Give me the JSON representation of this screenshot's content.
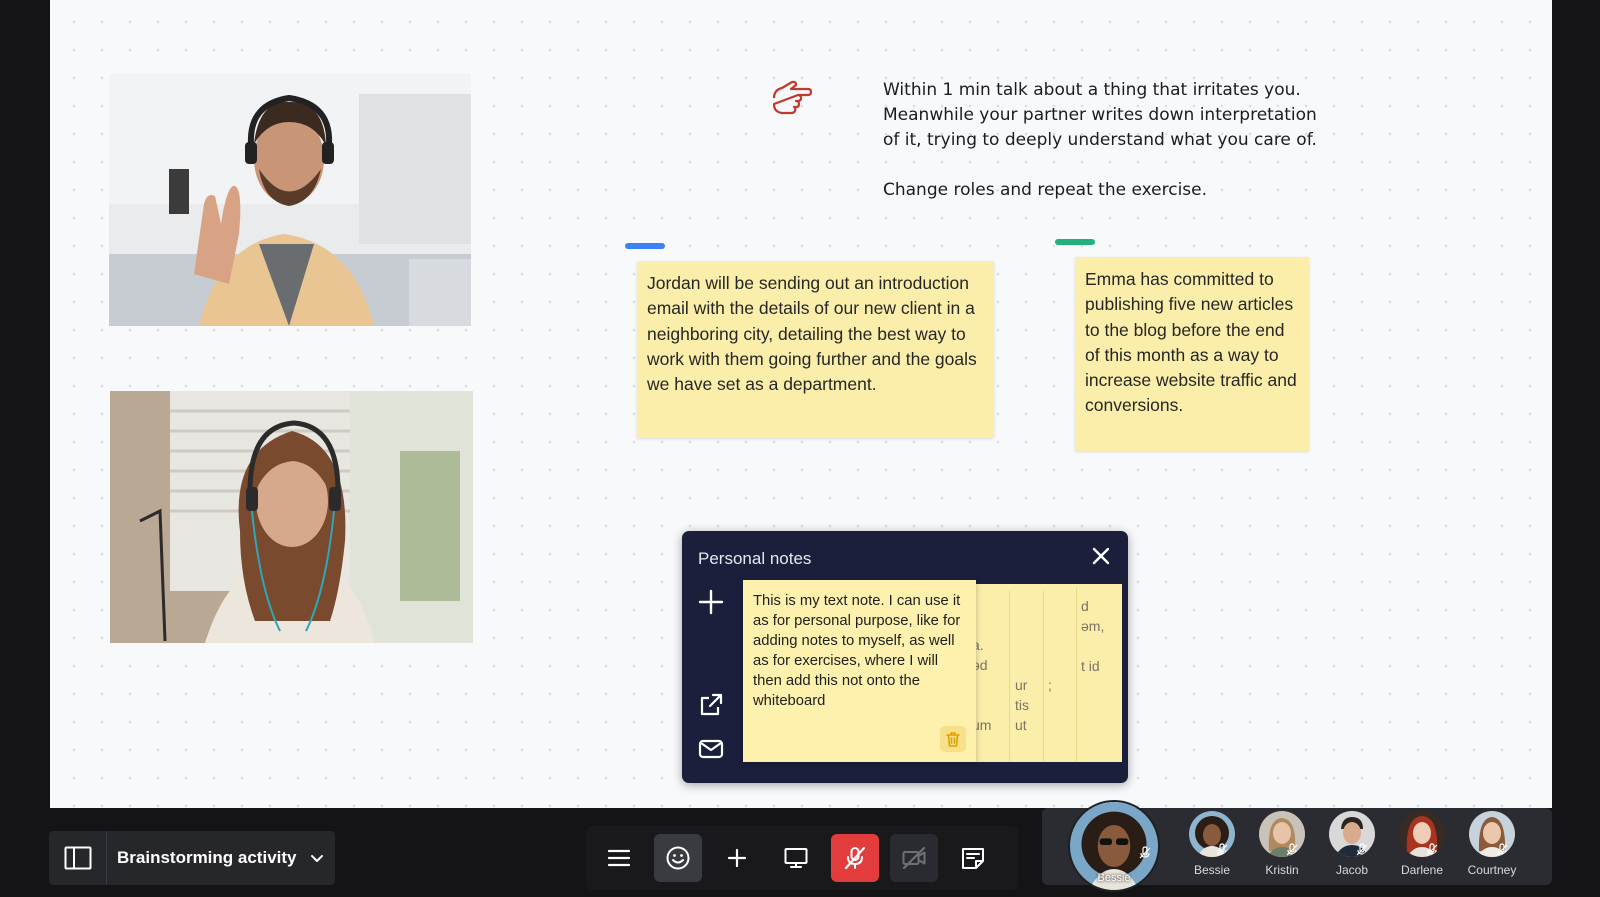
{
  "canvas": {
    "instruction": {
      "line1": "Within 1 min talk about a thing that irritates you.\nMeanwhile your partner writes down interpretation\nof it, trying to deeply understand what you care of.",
      "line2": "Change roles and repeat the exercise."
    },
    "stickies": [
      {
        "text": "Jordan will be sending out an introduction email with the details of our new client in a neighboring city, detailing the best way to work with them going further and the goals we have set as a department.",
        "tag_color": "#3b82f6"
      },
      {
        "text": "Emma has committed to publishing five new articles to the blog before the end of this month as a way to increase website traffic and conversions.",
        "tag_color": "#22b07d"
      }
    ]
  },
  "personal_notes": {
    "title": "Personal notes",
    "front_note": "This is my text note. I can use it as for personal purpose, like for adding notes to myself, as well as for exercises, where I will then add this not onto the whiteboard",
    "stack_fragments": [
      {
        "text": "a.\nəd\n\n\num"
      },
      {
        "text": "\n\nur\ntis\nut"
      },
      {
        "text": "\n\n;"
      },
      {
        "text": "d\nəm,\n\nt id"
      }
    ]
  },
  "bottom_bar": {
    "board_name": "Brainstorming activity"
  },
  "participants": {
    "main_speaker": "Bessie",
    "list": [
      {
        "name": "Bessie"
      },
      {
        "name": "Kristin"
      },
      {
        "name": "Jacob"
      },
      {
        "name": "Darlene"
      },
      {
        "name": "Courtney"
      }
    ]
  },
  "colors": {
    "accent_red": "#e23c3c",
    "sticky_yellow": "#fbeeaa",
    "panel_navy": "#1b1f3b"
  }
}
